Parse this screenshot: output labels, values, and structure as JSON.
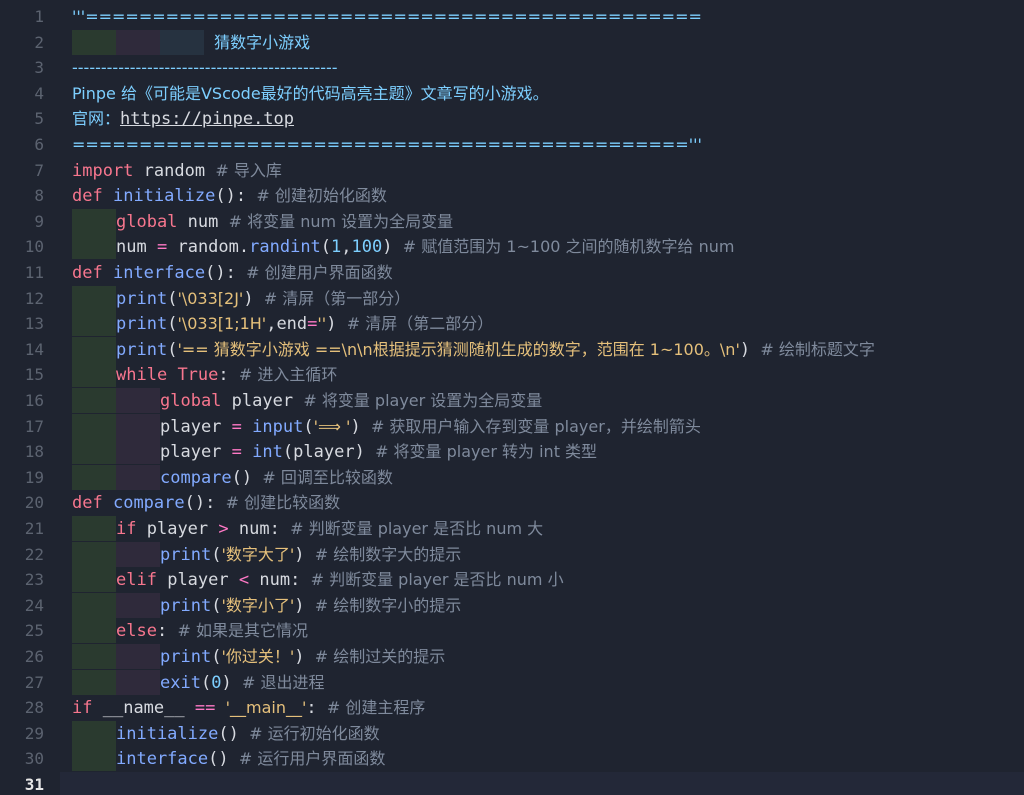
{
  "editor": {
    "active_line": 31,
    "lines": [
      {
        "n": "1",
        "text": "'''=============================================="
      },
      {
        "n": "2",
        "text": "····|····|····|·· 猜数字小游戏"
      },
      {
        "n": "3",
        "text": "----------------------------------------------"
      },
      {
        "n": "4",
        "text": "Pinpe 给《可能是VScode最好的代码高亮主题》文章写的小游戏。"
      },
      {
        "n": "5",
        "text": "官网：https://pinpe.top"
      },
      {
        "n": "6",
        "text": "=============================================='''"
      },
      {
        "n": "7",
        "text": "import random # 导入库"
      },
      {
        "n": "8",
        "text": "def initialize(): # 创建初始化函数"
      },
      {
        "n": "9",
        "text": "    global num # 将变量 num 设置为全局变量"
      },
      {
        "n": "10",
        "text": "    num = random.randint(1,100) # 赋值范围为 1~100 之间的随机数字给 num"
      },
      {
        "n": "11",
        "text": "def interface(): # 创建用户界面函数"
      },
      {
        "n": "12",
        "text": "    print('\\033[2J') # 清屏（第一部分）"
      },
      {
        "n": "13",
        "text": "    print('\\033[1;1H',end='') # 清屏（第二部分）"
      },
      {
        "n": "14",
        "text": "    print('== 猜数字小游戏 ==\\n\\n根据提示猜测随机生成的数字，范围在 1~100。\\n') # 绘制标题文字"
      },
      {
        "n": "15",
        "text": "    while True: # 进入主循环"
      },
      {
        "n": "16",
        "text": "        global player # 将变量 player 设置为全局变量"
      },
      {
        "n": "17",
        "text": "        player = input('⟹ ') # 获取用户输入存到变量 player，并绘制箭头"
      },
      {
        "n": "18",
        "text": "        player = int(player) # 将变量 player 转为 int 类型"
      },
      {
        "n": "19",
        "text": "        compare() # 回调至比较函数"
      },
      {
        "n": "20",
        "text": "def compare(): # 创建比较函数"
      },
      {
        "n": "21",
        "text": "    if player > num: # 判断变量 player 是否比 num 大"
      },
      {
        "n": "22",
        "text": "        print('数字大了') # 绘制数字大的提示"
      },
      {
        "n": "23",
        "text": "    elif player < num: # 判断变量 player 是否比 num 小"
      },
      {
        "n": "24",
        "text": "        print('数字小了') # 绘制数字小的提示"
      },
      {
        "n": "25",
        "text": "    else: # 如果是其它情况"
      },
      {
        "n": "26",
        "text": "        print('你过关！') # 绘制过关的提示"
      },
      {
        "n": "27",
        "text": "        exit(0) # 退出进程"
      },
      {
        "n": "28",
        "text": "if __name__ == '__main__': # 创建主程序"
      },
      {
        "n": "29",
        "text": "    initialize() # 运行初始化函数"
      },
      {
        "n": "30",
        "text": "    interface() # 运行用户界面函数"
      },
      {
        "n": "31",
        "text": ""
      }
    ]
  },
  "colors": {
    "background": "#1f2430",
    "keyword": "#f7768e",
    "function": "#82aaff",
    "string": "#e5c07b",
    "number": "#7dcfff",
    "comment": "#7f8a9c"
  }
}
